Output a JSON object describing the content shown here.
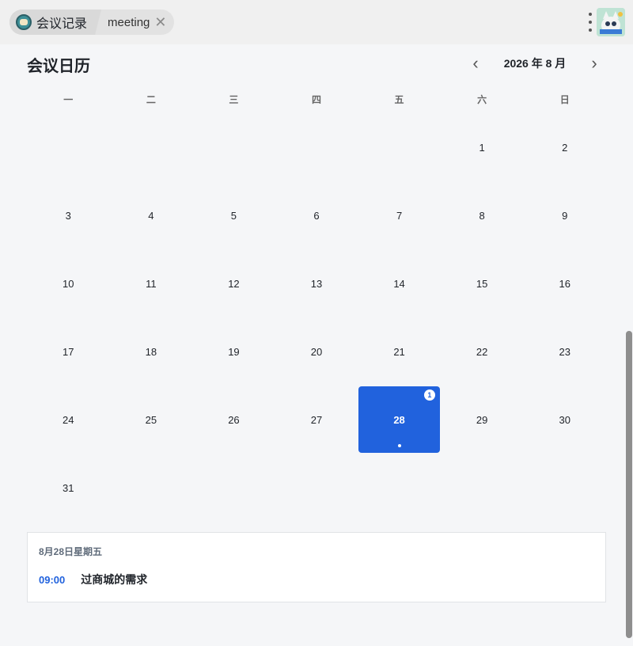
{
  "topbar": {
    "root_tab": "会议记录",
    "page_tab": "meeting"
  },
  "header": {
    "title": "会议日历",
    "month_label": "2026 年 8 月",
    "prev_label": "‹",
    "next_label": "›"
  },
  "calendar": {
    "weekdays": [
      "一",
      "二",
      "三",
      "四",
      "五",
      "六",
      "日"
    ],
    "first_weekday_index": 5,
    "days_in_month": 31,
    "selected_day": 28,
    "event_counts": {
      "28": "1"
    }
  },
  "event_panel": {
    "date_label": "8月28日星期五",
    "events": [
      {
        "time": "09:00",
        "title": "过商城的需求"
      }
    ]
  },
  "colors": {
    "accent": "#2162dd",
    "background": "#f5f6f8"
  },
  "icons": {
    "app": "app-logo-icon",
    "close": "close-icon",
    "menu": "kebab-menu-icon",
    "avatar": "avatar"
  }
}
